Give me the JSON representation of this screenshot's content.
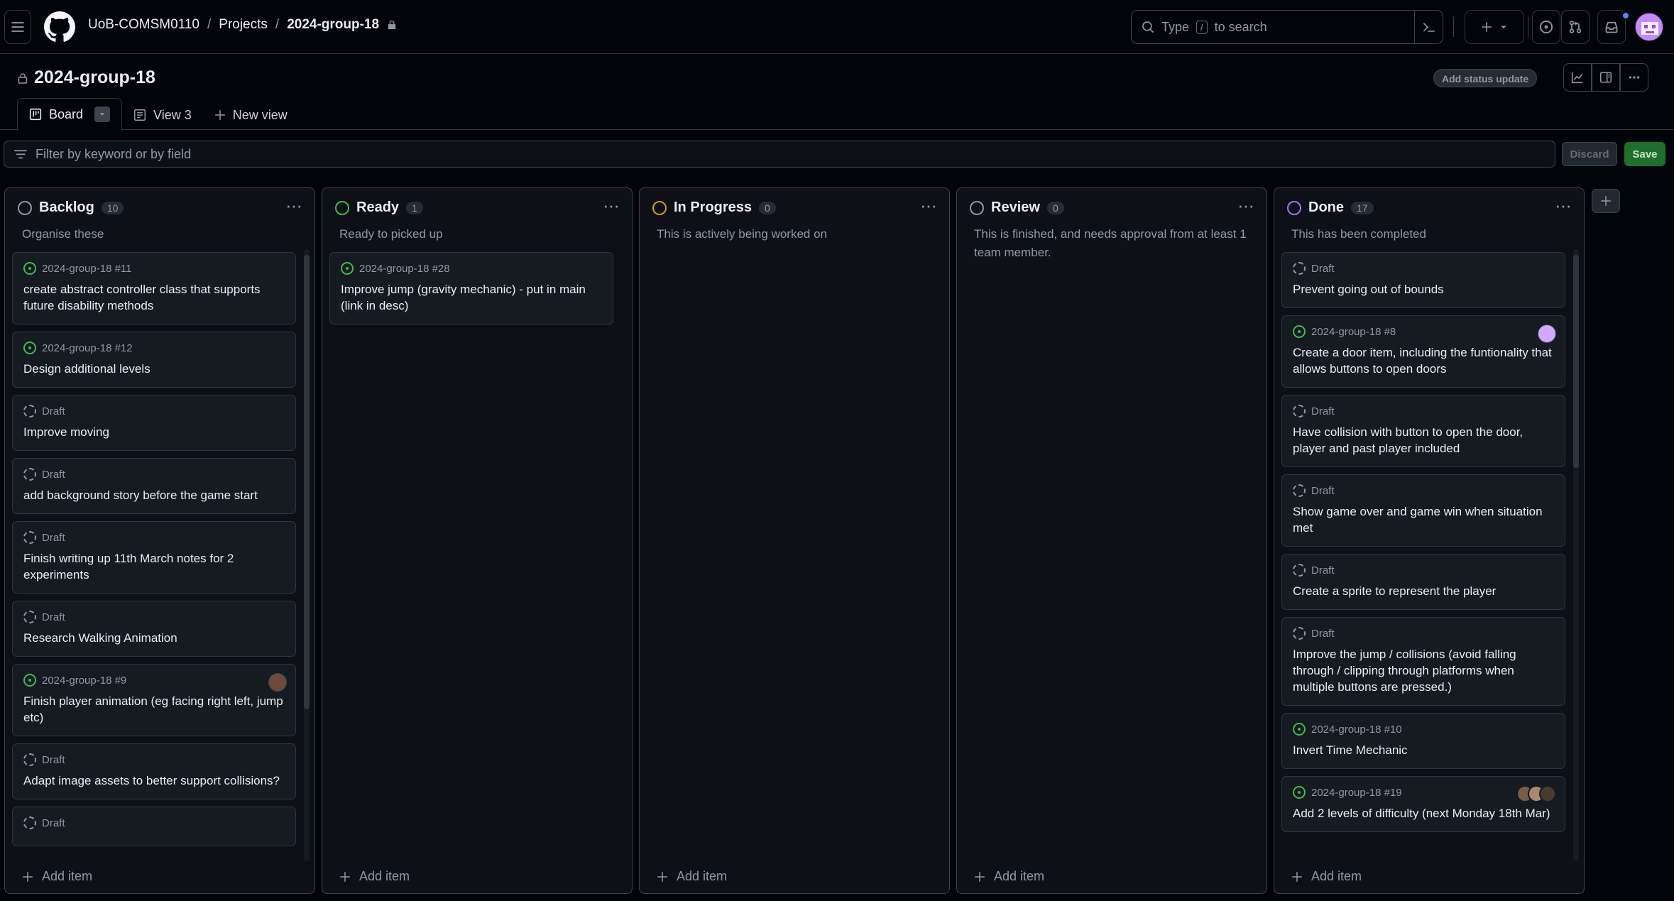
{
  "header": {
    "breadcrumb": [
      "UoB-COMSM0110",
      "Projects",
      "2024-group-18"
    ],
    "search_placeholder_prefix": "Type",
    "search_key": "/",
    "search_placeholder_suffix": "to search"
  },
  "project": {
    "title": "2024-group-18",
    "status_button": "Add status update",
    "tabs": [
      "Board",
      "View 3",
      "New view"
    ]
  },
  "filter": {
    "placeholder": "Filter by keyword or by field",
    "discard": "Discard",
    "save": "Save"
  },
  "add_item_label": "Add item",
  "colors": {
    "backlog": "#9198a1",
    "ready": "#3fb950",
    "in_progress": "#d29922",
    "review": "#9198a1",
    "done": "#a371f7"
  },
  "columns": [
    {
      "name": "Backlog",
      "count": "10",
      "description": "Organise these",
      "cards": [
        {
          "meta": "2024-group-18 #11",
          "kind": "issue",
          "title": "create abstract controller class that supports future disability methods"
        },
        {
          "meta": "2024-group-18 #12",
          "kind": "issue",
          "title": "Design additional levels"
        },
        {
          "meta": "Draft",
          "kind": "draft",
          "title": "Improve moving"
        },
        {
          "meta": "Draft",
          "kind": "draft",
          "title": "add background story before the game start"
        },
        {
          "meta": "Draft",
          "kind": "draft",
          "title": "Finish writing up 11th March notes for 2 experiments"
        },
        {
          "meta": "Draft",
          "kind": "draft",
          "title": "Research Walking Animation"
        },
        {
          "meta": "2024-group-18 #9",
          "kind": "issue",
          "title": "Finish player animation (eg facing right left, jump etc)",
          "avatar": "single"
        },
        {
          "meta": "Draft",
          "kind": "draft",
          "title": "Adapt image assets to better support collisions?"
        },
        {
          "meta": "Draft",
          "kind": "draft",
          "title": ""
        }
      ]
    },
    {
      "name": "Ready",
      "count": "1",
      "description": "Ready to picked up",
      "cards": [
        {
          "meta": "2024-group-18 #28",
          "kind": "issue",
          "title": "Improve jump (gravity mechanic) - put in main (link in desc)"
        }
      ]
    },
    {
      "name": "In Progress",
      "count": "0",
      "description": "This is actively being worked on",
      "cards": []
    },
    {
      "name": "Review",
      "count": "0",
      "description": "This is finished, and needs approval from at least 1 team member.",
      "cards": []
    },
    {
      "name": "Done",
      "count": "17",
      "description": "This has been completed",
      "cards": [
        {
          "meta": "Draft",
          "kind": "draft",
          "title": "Prevent going out of bounds"
        },
        {
          "meta": "2024-group-18 #8",
          "kind": "issue",
          "title": "Create a door item, including the funtionality that allows buttons to open doors",
          "avatar": "single"
        },
        {
          "meta": "Draft",
          "kind": "draft",
          "title": "Have collision with button to open the door, player and past player included"
        },
        {
          "meta": "Draft",
          "kind": "draft",
          "title": "Show game over and game win when situation met"
        },
        {
          "meta": "Draft",
          "kind": "draft",
          "title": "Create a sprite to represent the player"
        },
        {
          "meta": "Draft",
          "kind": "draft",
          "title": "Improve the jump / collisions (avoid falling through / clipping through platforms when multiple buttons are pressed.)"
        },
        {
          "meta": "2024-group-18 #10",
          "kind": "issue",
          "title": "Invert Time Mechanic"
        },
        {
          "meta": "2024-group-18 #19",
          "kind": "issue",
          "title": "Add 2 levels of difficulty (next Monday 18th Mar)",
          "avatar": "multi"
        }
      ]
    }
  ]
}
